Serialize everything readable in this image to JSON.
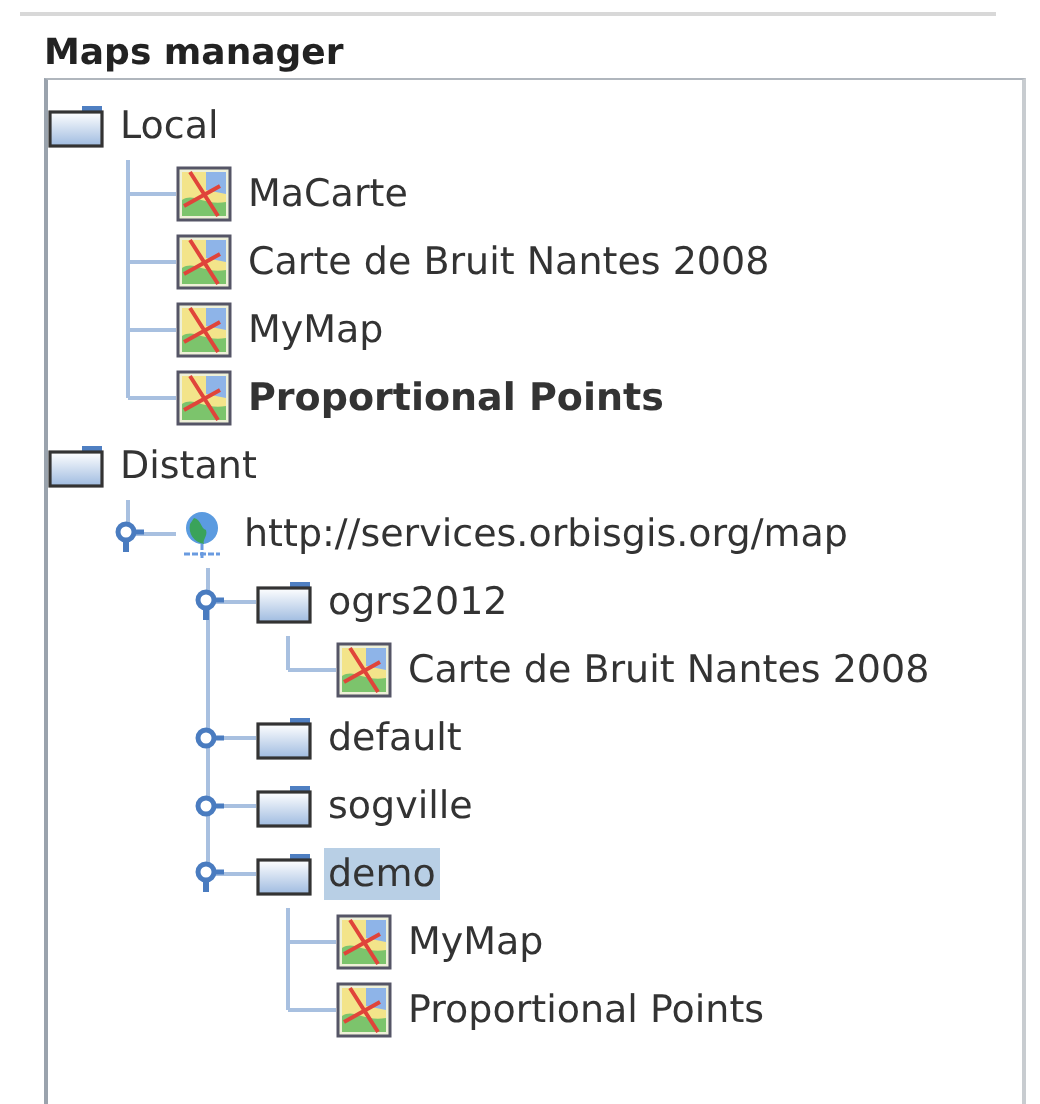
{
  "panel": {
    "title": "Maps manager"
  },
  "tree": [
    {
      "kind": "folder",
      "label": "Local",
      "bold": false,
      "selected": false,
      "expanded": true,
      "children": [
        {
          "kind": "map",
          "label": "MaCarte",
          "bold": false,
          "selected": false
        },
        {
          "kind": "map",
          "label": "Carte de Bruit Nantes 2008",
          "bold": false,
          "selected": false
        },
        {
          "kind": "map",
          "label": "MyMap",
          "bold": false,
          "selected": false
        },
        {
          "kind": "map",
          "label": "Proportional Points",
          "bold": true,
          "selected": false
        }
      ]
    },
    {
      "kind": "folder",
      "label": "Distant",
      "bold": false,
      "selected": false,
      "expanded": true,
      "children": [
        {
          "kind": "server",
          "label": "http://services.orbisgis.org/map",
          "bold": false,
          "selected": false,
          "expanded": true,
          "children": [
            {
              "kind": "folder",
              "label": "ogrs2012",
              "bold": false,
              "selected": false,
              "expanded": true,
              "children": [
                {
                  "kind": "map",
                  "label": "Carte de Bruit Nantes 2008",
                  "bold": false,
                  "selected": false
                }
              ]
            },
            {
              "kind": "folder",
              "label": "default",
              "bold": false,
              "selected": false,
              "expanded": false
            },
            {
              "kind": "folder",
              "label": "sogville",
              "bold": false,
              "selected": false,
              "expanded": false
            },
            {
              "kind": "folder",
              "label": "demo",
              "bold": false,
              "selected": true,
              "expanded": true,
              "children": [
                {
                  "kind": "map",
                  "label": "MyMap",
                  "bold": false,
                  "selected": false
                },
                {
                  "kind": "map",
                  "label": "Proportional Points",
                  "bold": false,
                  "selected": false
                }
              ]
            }
          ]
        }
      ]
    }
  ]
}
